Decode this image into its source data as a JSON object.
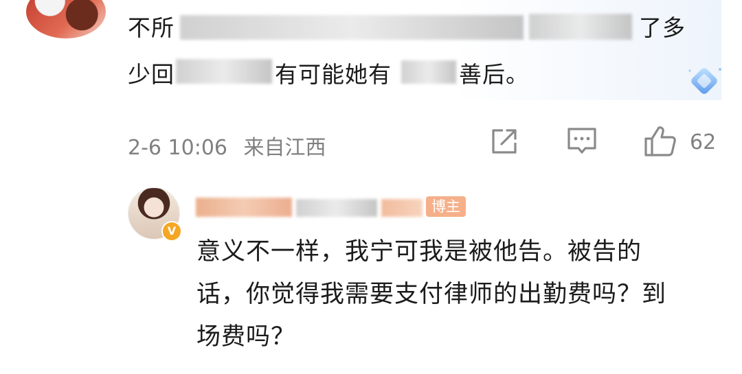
{
  "top_comment": {
    "line1_visible": "不所",
    "line1_tail": "了多",
    "line2_head": "少回",
    "line2_mid": "有可能她有",
    "line2_tail": "善后。",
    "timestamp": "2-6 10:06",
    "location": "来自江西",
    "like_count": "62"
  },
  "reply": {
    "author_badge": "博主",
    "verified_glyph": "V",
    "lines": [
      "意义不一样，我宁可我是被他告。被告的",
      "话，你觉得我需要支付律师的出勤费吗？到",
      "场费吗？"
    ]
  },
  "icons": {
    "share": "share-icon",
    "comment": "comment-icon",
    "like": "thumbs-up-icon",
    "diamond": "diamond-badge-icon"
  },
  "colors": {
    "meta_gray": "#808080",
    "blur_gray": "#c9c9c9",
    "badge_orange": "#f5a623"
  }
}
